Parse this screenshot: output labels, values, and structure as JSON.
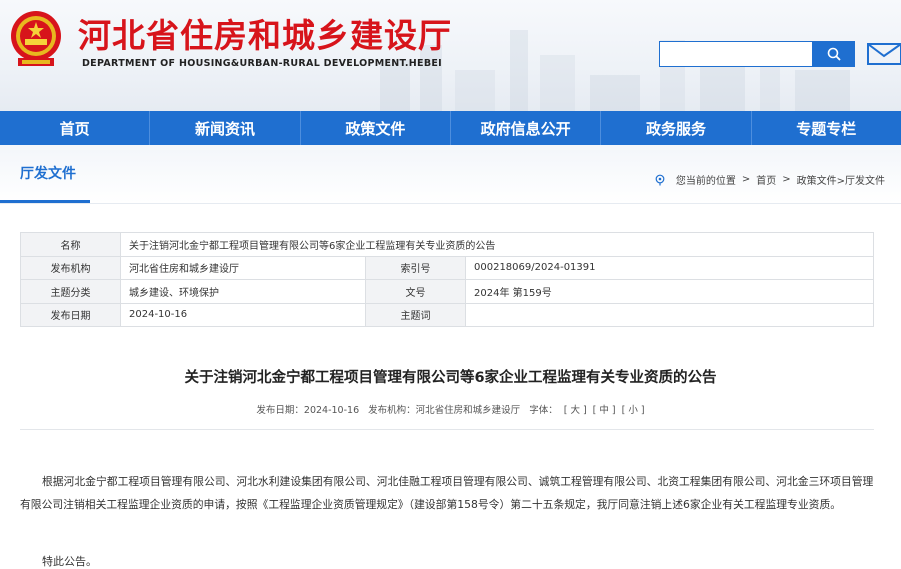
{
  "header": {
    "title": "河北省住房和城乡建设厅",
    "subtitle": "DEPARTMENT OF HOUSING&URBAN-RURAL DEVELOPMENT.HEBEI",
    "search_placeholder": "",
    "search_icon": "search-icon",
    "mail_icon": "mail-icon"
  },
  "nav": [
    "首页",
    "新闻资讯",
    "政策文件",
    "政府信息公开",
    "政务服务",
    "专题专栏"
  ],
  "section": {
    "title": "厅发文件",
    "crumb_prefix": "您当前的位置",
    "crumb_home": "首页",
    "crumb_tail": "政策文件>厅发文件"
  },
  "meta": {
    "name_label": "名称",
    "name_value": "关于注销河北金宁都工程项目管理有限公司等6家企业工程监理有关专业资质的公告",
    "org_label": "发布机构",
    "org_value": "河北省住房和城乡建设厅",
    "index_label": "索引号",
    "index_value": "000218069/2024-01391",
    "topic_label": "主题分类",
    "topic_value": "城乡建设、环境保护",
    "docno_label": "文号",
    "docno_value": "2024年 第159号",
    "date_label": "发布日期",
    "date_value": "2024-10-16",
    "keyword_label": "主题词",
    "keyword_value": ""
  },
  "article": {
    "title": "关于注销河北金宁都工程项目管理有限公司等6家企业工程监理有关专业资质的公告",
    "date_text": "发布日期：2024-10-16",
    "org_text": "发布机构：河北省住房和城乡建设厅",
    "font_label": "字体：",
    "font_large": "[ 大 ]",
    "font_medium": "[ 中 ]",
    "font_small": "[ 小 ]",
    "body": "根据河北金宁都工程项目管理有限公司、河北水利建设集团有限公司、河北佳融工程项目管理有限公司、诚筑工程管理有限公司、北资工程集团有限公司、河北金三环项目管理有限公司注销相关工程监理企业资质的申请，按照《工程监理企业资质管理规定》（建设部第158号令）第二十五条规定，我厅同意注销上述6家企业有关工程监理专业资质。",
    "closing": "特此公告。"
  },
  "colors": {
    "brand_red": "#d7141b",
    "brand_blue": "#1f6fd0"
  }
}
